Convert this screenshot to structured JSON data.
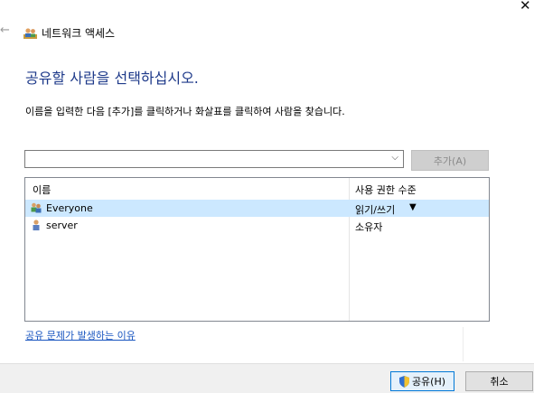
{
  "window": {
    "close_glyph": "✕",
    "back_glyph": "←"
  },
  "title": {
    "text": "네트워크 액세스",
    "icon": "network-users-icon"
  },
  "heading": "공유할 사람을 선택하십시오.",
  "instruction": "이름을 입력한 다음 [추가]를 클릭하거나 화살표를 클릭하여 사람을 찾습니다.",
  "combo": {
    "value": "",
    "arrow": "⌵"
  },
  "add_button": "추가(A)",
  "list": {
    "columns": {
      "name": "이름",
      "permission": "사용 권한 수준"
    },
    "rows": [
      {
        "name": "Everyone",
        "permission": "읽기/쓰기",
        "dropdown": "▼",
        "selected": true,
        "icon": "group-icon"
      },
      {
        "name": "server",
        "permission": "소유자",
        "selected": false,
        "icon": "user-icon"
      }
    ]
  },
  "help_link": "공유 문제가 발생하는 이유",
  "buttons": {
    "share": "공유(H)",
    "cancel": "취소"
  },
  "colors": {
    "heading": "#1e3a8a",
    "selection": "#cce8ff",
    "link": "#1a56c0"
  }
}
